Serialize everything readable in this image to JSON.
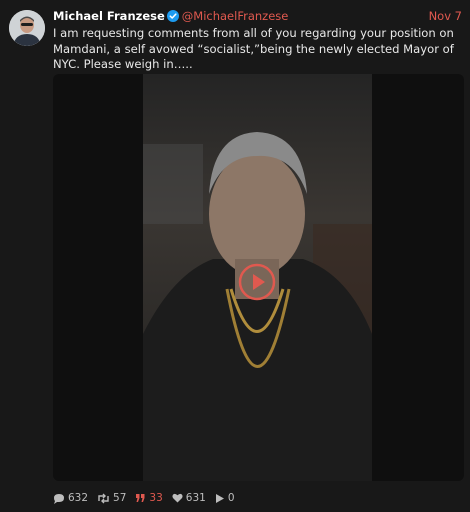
{
  "post": {
    "author_name": "Michael Franzese",
    "handle": "@MichaelFranzese",
    "date": "Nov 7",
    "body": "I am requesting comments from all of you regarding your position on Mamdani, a self avowed “socialist,”being the newly elected Mayor of NYC. Please weigh in…..",
    "media_type": "video"
  },
  "actions": {
    "replies": "632",
    "reposts": "57",
    "quotes": "33",
    "likes": "631",
    "views": "0"
  },
  "colors": {
    "background": "#181818",
    "accent": "#e0594f",
    "verified": "#1d9bf0"
  },
  "icons": [
    "verified-badge-icon",
    "play-icon",
    "reply-icon",
    "repost-icon",
    "quote-icon",
    "like-icon",
    "views-icon"
  ]
}
